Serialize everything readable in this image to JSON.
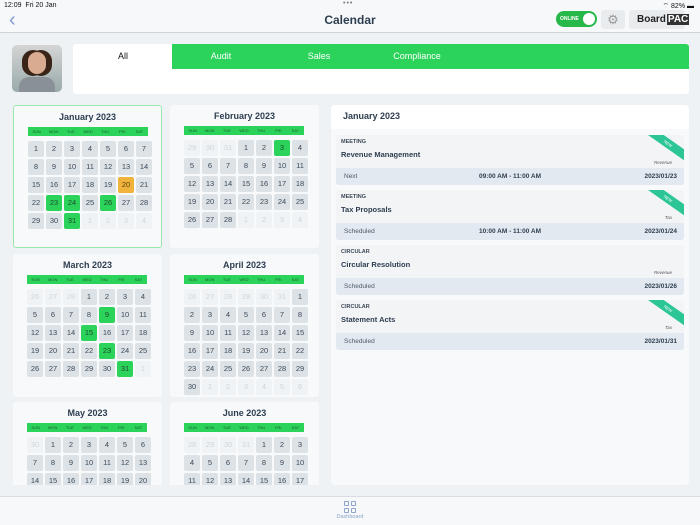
{
  "status_bar": {
    "time": "12:09",
    "date": "Fri 20 Jan",
    "battery": "82%"
  },
  "header": {
    "title": "Calendar",
    "online_label": "ONLINE",
    "logo_text": "Board",
    "logo_box": "PAC"
  },
  "tabs": [
    {
      "label": "All",
      "active": true
    },
    {
      "label": "Audit"
    },
    {
      "label": "Sales"
    },
    {
      "label": "Compliance"
    }
  ],
  "weekdays": [
    "SUN",
    "MON",
    "TUE",
    "WED",
    "THU",
    "FRI",
    "SAT"
  ],
  "months": [
    {
      "title": "January 2023",
      "selected": true,
      "lead": [],
      "days": 31,
      "trail": [
        1,
        2,
        3,
        4
      ],
      "events": [
        23,
        24,
        26,
        31
      ],
      "today": 20
    },
    {
      "title": "February 2023",
      "lead": [
        29,
        30,
        31
      ],
      "days": 28,
      "trail": [
        1,
        2,
        3,
        4
      ],
      "events": [
        3
      ]
    },
    {
      "title": "March 2023",
      "lead": [
        26,
        27,
        28
      ],
      "days": 31,
      "trail": [
        1
      ],
      "events": [
        9,
        15,
        23,
        31
      ]
    },
    {
      "title": "April 2023",
      "lead": [
        26,
        27,
        28,
        29,
        30,
        31
      ],
      "days": 30,
      "trail": [
        1,
        2,
        3,
        4,
        5,
        6
      ],
      "events": []
    },
    {
      "title": "May 2023",
      "lead": [
        30
      ],
      "days": 31,
      "trail": [],
      "events": []
    },
    {
      "title": "June 2023",
      "lead": [
        28,
        29,
        30,
        31
      ],
      "days": 30,
      "trail": [],
      "events": []
    }
  ],
  "agenda": {
    "title": "January 2023",
    "items": [
      {
        "kind": "MEETING",
        "name": "Revenue Management",
        "tag": "Revenue",
        "status": "Next",
        "time": "09:00 AM - 11:00 AM",
        "date": "2023/01/23",
        "new": "NEW"
      },
      {
        "kind": "MEETING",
        "name": "Tax Proposals",
        "tag": "Tax",
        "status": "Scheduled",
        "time": "10:00 AM - 11:00 AM",
        "date": "2023/01/24",
        "new": "NEW"
      },
      {
        "kind": "CIRCULAR",
        "name": "Circular Resolution",
        "tag": "Revenue",
        "status": "Scheduled",
        "time": "",
        "date": "2023/01/26"
      },
      {
        "kind": "CIRCULAR",
        "name": "Statement Acts",
        "tag": "Tax",
        "status": "Scheduled",
        "time": "",
        "date": "2023/01/31",
        "new": "NEW"
      }
    ]
  },
  "bottom_nav": {
    "dashboard": "Dashboard"
  },
  "colors": {
    "accent": "#2bd35b",
    "today": "#f0b33c",
    "ribbon": "#2cc596"
  }
}
